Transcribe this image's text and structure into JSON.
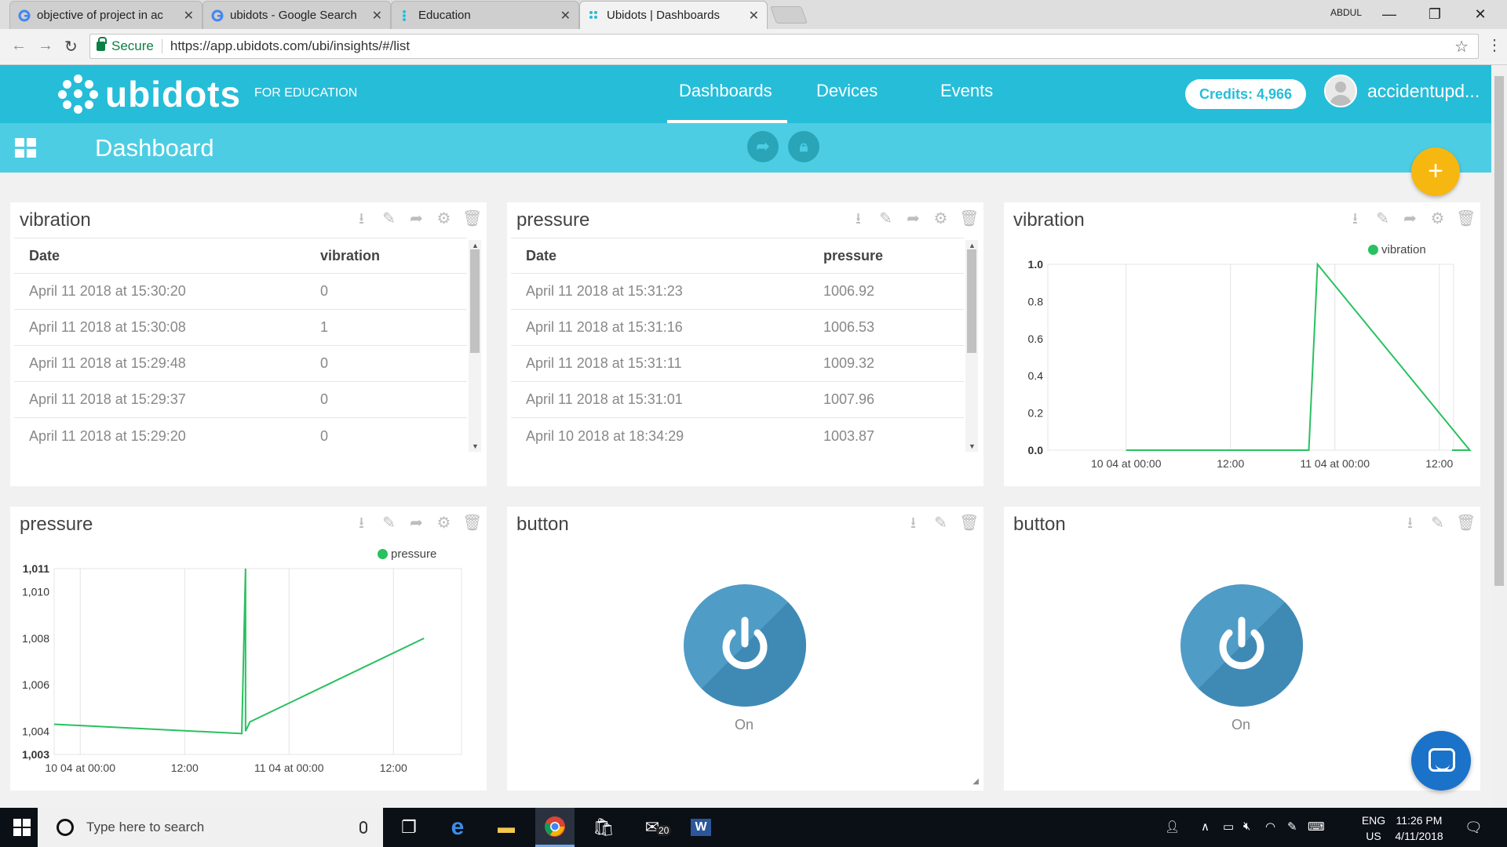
{
  "browser": {
    "tabs": [
      {
        "title": "objective of project in ac",
        "icon": "google-icon"
      },
      {
        "title": "ubidots - Google Search",
        "icon": "google-icon"
      },
      {
        "title": "Education",
        "icon": "ubidots-icon"
      },
      {
        "title": "Ubidots | Dashboards",
        "icon": "ubidots-icon"
      }
    ],
    "window_user": "ABDUL",
    "secure_label": "Secure",
    "url": "https://app.ubidots.com/ubi/insights/#/list"
  },
  "header": {
    "logo_text": "ubidots",
    "edition": "FOR EDUCATION",
    "nav": [
      "Dashboards",
      "Devices",
      "Events"
    ],
    "active_nav": "Dashboards",
    "credits": "Credits: 4,966",
    "username": "accidentupd...",
    "accent_color": "#26bdd9"
  },
  "subheader": {
    "title": "Dashboard"
  },
  "widgets": {
    "vibration_table": {
      "title": "vibration",
      "columns": [
        "Date",
        "vibration"
      ],
      "rows": [
        [
          "April 11 2018 at 15:30:20",
          "0"
        ],
        [
          "April 11 2018 at 15:30:08",
          "1"
        ],
        [
          "April 11 2018 at 15:29:48",
          "0"
        ],
        [
          "April 11 2018 at 15:29:37",
          "0"
        ],
        [
          "April 11 2018 at 15:29:20",
          "0"
        ]
      ]
    },
    "pressure_table": {
      "title": "pressure",
      "columns": [
        "Date",
        "pressure"
      ],
      "rows": [
        [
          "April 11 2018 at 15:31:23",
          "1006.92"
        ],
        [
          "April 11 2018 at 15:31:16",
          "1006.53"
        ],
        [
          "April 11 2018 at 15:31:11",
          "1009.32"
        ],
        [
          "April 11 2018 at 15:31:01",
          "1007.96"
        ],
        [
          "April 10 2018 at 18:34:29",
          "1003.87"
        ]
      ]
    },
    "vibration_chart": {
      "title": "vibration"
    },
    "pressure_chart": {
      "title": "pressure"
    },
    "button1": {
      "title": "button",
      "state": "On"
    },
    "button2": {
      "title": "button",
      "state": "On"
    }
  },
  "chart_data": [
    {
      "type": "line",
      "title": "vibration",
      "legend": [
        "vibration"
      ],
      "legend_position": "top-right",
      "series_color": "#28c15f",
      "x_tick_labels": [
        "10 04 at 00:00",
        "12:00",
        "11 04 at 00:00",
        "12:00"
      ],
      "y_tick_labels": [
        "1.0",
        "0.8",
        "0.6",
        "0.4",
        "0.2",
        "0.0"
      ],
      "ylim": [
        0,
        1
      ],
      "grid": true,
      "series": [
        {
          "name": "vibration",
          "x": [
            "10 04 at 00:00",
            "10 04 at 21:00",
            "10 04 at 22:00",
            "11 04 at 15:30"
          ],
          "y": [
            0,
            0,
            1,
            0
          ]
        }
      ]
    },
    {
      "type": "line",
      "title": "pressure",
      "legend": [
        "pressure"
      ],
      "legend_position": "top-right",
      "series_color": "#28c15f",
      "x_tick_labels": [
        "10 04 at 00:00",
        "12:00",
        "11 04 at 00:00",
        "12:00"
      ],
      "y_tick_labels": [
        "1,011",
        "1,010",
        "1,008",
        "1,006",
        "1,004",
        "1,003"
      ],
      "ylim": [
        1003,
        1011
      ],
      "grid": true,
      "series": [
        {
          "name": "pressure",
          "x": [
            "09 04 at 21:00",
            "10 04 at 18:34",
            "10 04 at 19:00",
            "10 04 at 19:00",
            "10 04 at 19:30",
            "11 04 at 15:31"
          ],
          "y": [
            1004.3,
            1003.9,
            1011,
            1004.0,
            1004.4,
            1008.0
          ]
        }
      ]
    }
  ],
  "taskbar": {
    "search_placeholder": "Type here to search",
    "mail_badge": "20",
    "lang_line1": "ENG",
    "lang_line2": "US",
    "time": "11:26 PM",
    "date": "4/11/2018"
  }
}
